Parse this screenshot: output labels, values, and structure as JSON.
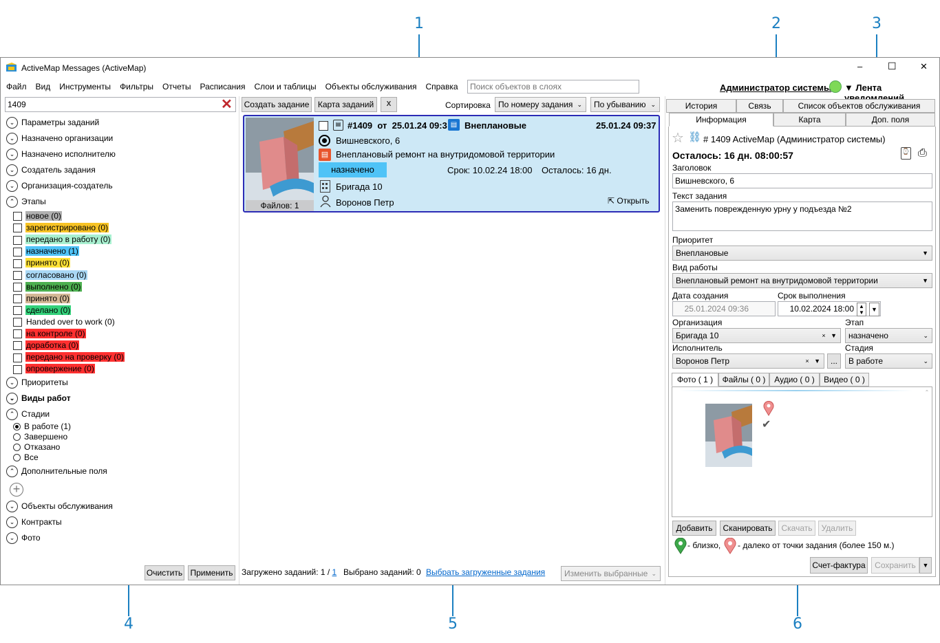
{
  "callouts": [
    "1",
    "2",
    "3",
    "4",
    "5",
    "6"
  ],
  "app": {
    "title": "ActiveMap Messages (ActiveMap)",
    "min": "–",
    "max": "☐",
    "close": "✕"
  },
  "menu": [
    "Файл",
    "Вид",
    "Инструменты",
    "Фильтры",
    "Отчеты",
    "Расписания",
    "Слои и таблицы",
    "Объекты обслуживания",
    "Справка"
  ],
  "search_layers": {
    "placeholder": "Поиск объектов в слоях"
  },
  "user": {
    "name": "Администратор системы",
    "status_color": "#7ed957",
    "feed": "▼ Лента уведомлений"
  },
  "left": {
    "search_value": "1409",
    "filters_top": [
      "Параметры заданий",
      "Назначено организации",
      "Назначено исполнителю",
      "Создатель задания",
      "Организация-создатель",
      "Этапы"
    ],
    "stages": [
      {
        "label": "новое (0)",
        "color": "#b0b0b0"
      },
      {
        "label": "зарегистрировано (0)",
        "color": "#f7c325"
      },
      {
        "label": "передано в работу (0)",
        "color": "#a8f0d0"
      },
      {
        "label": "назначено (1)",
        "color": "#4fc3f7"
      },
      {
        "label": "принято (0)",
        "color": "#ffe135"
      },
      {
        "label": "согласовано (0)",
        "color": "#a9d8f5"
      },
      {
        "label": "выполнено (0)",
        "color": "#4caf50"
      },
      {
        "label": "принято (0)",
        "color": "#d4b896"
      },
      {
        "label": "сделано (0)",
        "color": "#33d17a"
      },
      {
        "label": "Handed over to work (0)",
        "color": "#ffffff"
      },
      {
        "label": "на контроле (0)",
        "color": "#ff3030"
      },
      {
        "label": "доработка (0)",
        "color": "#ff3030"
      },
      {
        "label": "передано на проверку (0)",
        "color": "#ff3030"
      },
      {
        "label": "опровержение (0)",
        "color": "#ff3030"
      }
    ],
    "priorities": "Приоритеты",
    "work_types": "Виды работ",
    "stadia": "Стадии",
    "stadia_opts": [
      "В работе (1)",
      "Завершено",
      "Отказано",
      "Все"
    ],
    "extra_fields": "Дополнительные поля",
    "bottom_filters": [
      "Объекты обслуживания",
      "Контракты",
      "Фото"
    ],
    "clear_btn": "Очистить",
    "apply_btn": "Применить"
  },
  "center": {
    "create_btn": "Создать задание",
    "map_btn": "Карта заданий",
    "sort_label": "Сортировка",
    "sort_by": "По номеру задания",
    "sort_dir": "По убыванию",
    "card": {
      "files": "Файлов: 1",
      "num": "#1409",
      "from": "от",
      "date": "25.01.24 09:3",
      "type": "Внеплановые",
      "date_right": "25.01.24 09:37",
      "address": "Вишневского, 6",
      "work": "Внеплановый ремонт на внутридомовой территории",
      "stage": "назначено",
      "stage_color": "#4fc3f7",
      "deadline": "Срок: 10.02.24 18:00",
      "remaining": "Осталось: 16 дн.",
      "brigade": "Бригада 10",
      "person": "Воронов Петр",
      "open": "Открыть"
    },
    "loaded_label": "Загружено заданий: 1 /",
    "loaded_link": "1",
    "selected": "Выбрано заданий: 0",
    "select_link": "Выбрать загруженные задания",
    "change_btn": "Изменить выбранные"
  },
  "right": {
    "tabs_top": [
      "История",
      "Связь",
      "Список объектов обслуживания"
    ],
    "tabs_bottom": [
      "Информация",
      "Карта",
      "Доп. поля"
    ],
    "header": "# 1409  ActiveMap (Администратор системы)",
    "remaining": "Осталось: 16 дн. 08:00:57",
    "title_label": "Заголовок",
    "title_value": "Вишневского, 6",
    "text_label": "Текст задания",
    "text_value": "Заменить поврежденную урну у подъезда №2",
    "priority_label": "Приоритет",
    "priority_value": "Внеплановые",
    "work_label": "Вид работы",
    "work_value": "Внеплановый ремонт на внутридомовой территории",
    "created_label": "Дата создания",
    "created_value": "25.01.2024 09:36",
    "deadline_label": "Срок выполнения",
    "deadline_value": "10.02.2024 18:00",
    "org_label": "Организация",
    "org_value": "Бригада 10",
    "stage_label": "Этап",
    "stage_value": "назначено",
    "exec_label": "Исполнитель",
    "exec_value": "Воронов Петр",
    "stadia_label": "Стадия",
    "stadia_value": "В работе",
    "media_tabs": [
      "Фото  ( 1 )",
      "Файлы  ( 0 )",
      "Аудио  ( 0 )",
      "Видео  ( 0 )"
    ],
    "btn_add": "Добавить",
    "btn_scan": "Сканировать",
    "btn_download": "Скачать",
    "btn_delete": "Удалить",
    "legend_near": "- близко,",
    "legend_far": "- далеко от точки задания (более 150 м.)",
    "invoice_btn": "Счет-фактура",
    "save_btn": "Сохранить"
  }
}
